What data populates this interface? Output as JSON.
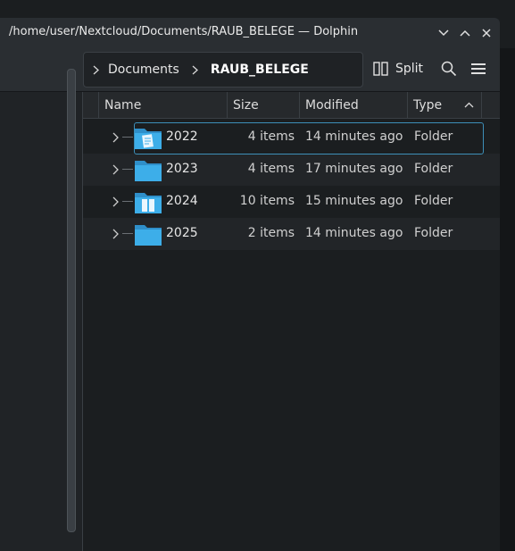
{
  "window": {
    "title": "/home/user/Nextcloud/Documents/RAUB_BELEGE — Dolphin",
    "controls": [
      "chevron-down-icon",
      "chevron-up-icon",
      "close-icon"
    ]
  },
  "toolbar": {
    "breadcrumb": [
      "Documents",
      "RAUB_BELEGE"
    ],
    "split_label": "Split",
    "search_icon": "search-icon",
    "menu_icon": "hamburger-menu-icon"
  },
  "columns": {
    "name": "Name",
    "size": "Size",
    "modified": "Modified",
    "type": "Type"
  },
  "rows": [
    {
      "name": "2022",
      "size": "4 items",
      "modified": "14 minutes ago",
      "type": "Folder"
    },
    {
      "name": "2023",
      "size": "4 items",
      "modified": "17 minutes ago",
      "type": "Folder"
    },
    {
      "name": "2024",
      "size": "10 items",
      "modified": "15 minutes ago",
      "type": "Folder"
    },
    {
      "name": "2025",
      "size": "2 items",
      "modified": "14 minutes ago",
      "type": "Folder"
    }
  ],
  "colors": {
    "accent": "#3d8fb8",
    "folder": "#3daee9"
  }
}
